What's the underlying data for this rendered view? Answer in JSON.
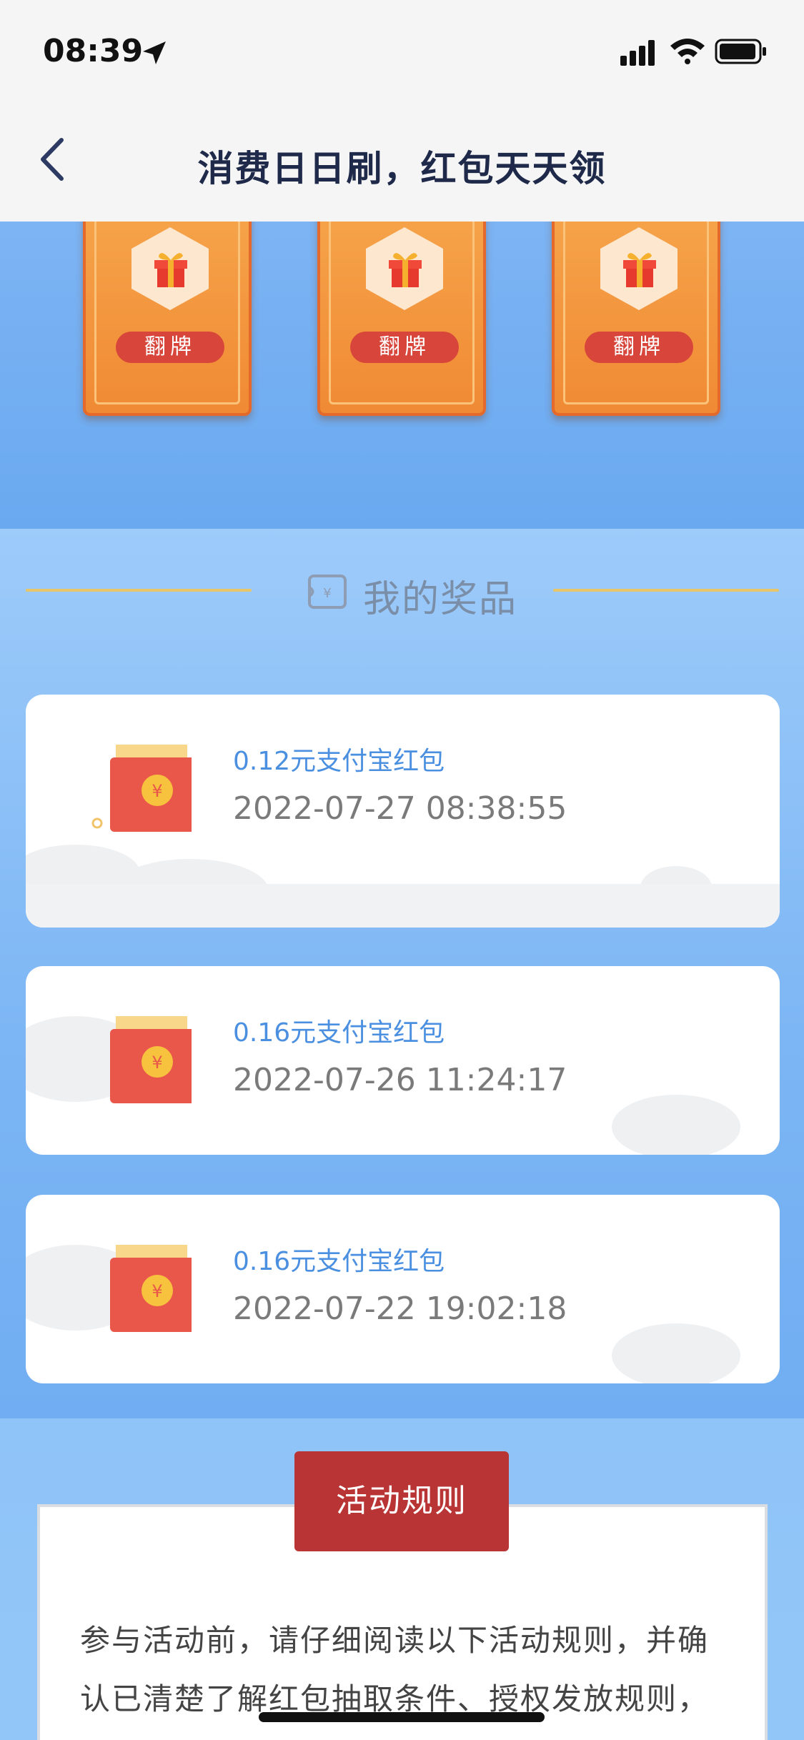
{
  "status_bar": {
    "time": "08:39"
  },
  "nav": {
    "title": "消费日日刷，红包天天领"
  },
  "flip_cards": [
    {
      "button_label": "翻牌"
    },
    {
      "button_label": "翻牌"
    },
    {
      "button_label": "翻牌"
    }
  ],
  "prizes": {
    "title": "我的奖品",
    "items": [
      {
        "name": "0.12元支付宝红包",
        "time": "2022-07-27 08:38:55"
      },
      {
        "name": "0.16元支付宝红包",
        "time": "2022-07-26 11:24:17"
      },
      {
        "name": "0.16元支付宝红包",
        "time": "2022-07-22 19:02:18"
      }
    ]
  },
  "rules": {
    "badge": "活动规则",
    "text": "参与活动前，请仔细阅读以下活动规则，并确认已清楚了解红包抽取条件、授权发放规则，并同意遵守本规则"
  },
  "colors": {
    "accent_blue": "#4a8fe0",
    "card_orange": "#f08a34",
    "rules_red": "#b93535",
    "divider_gold": "#e7c66a"
  }
}
